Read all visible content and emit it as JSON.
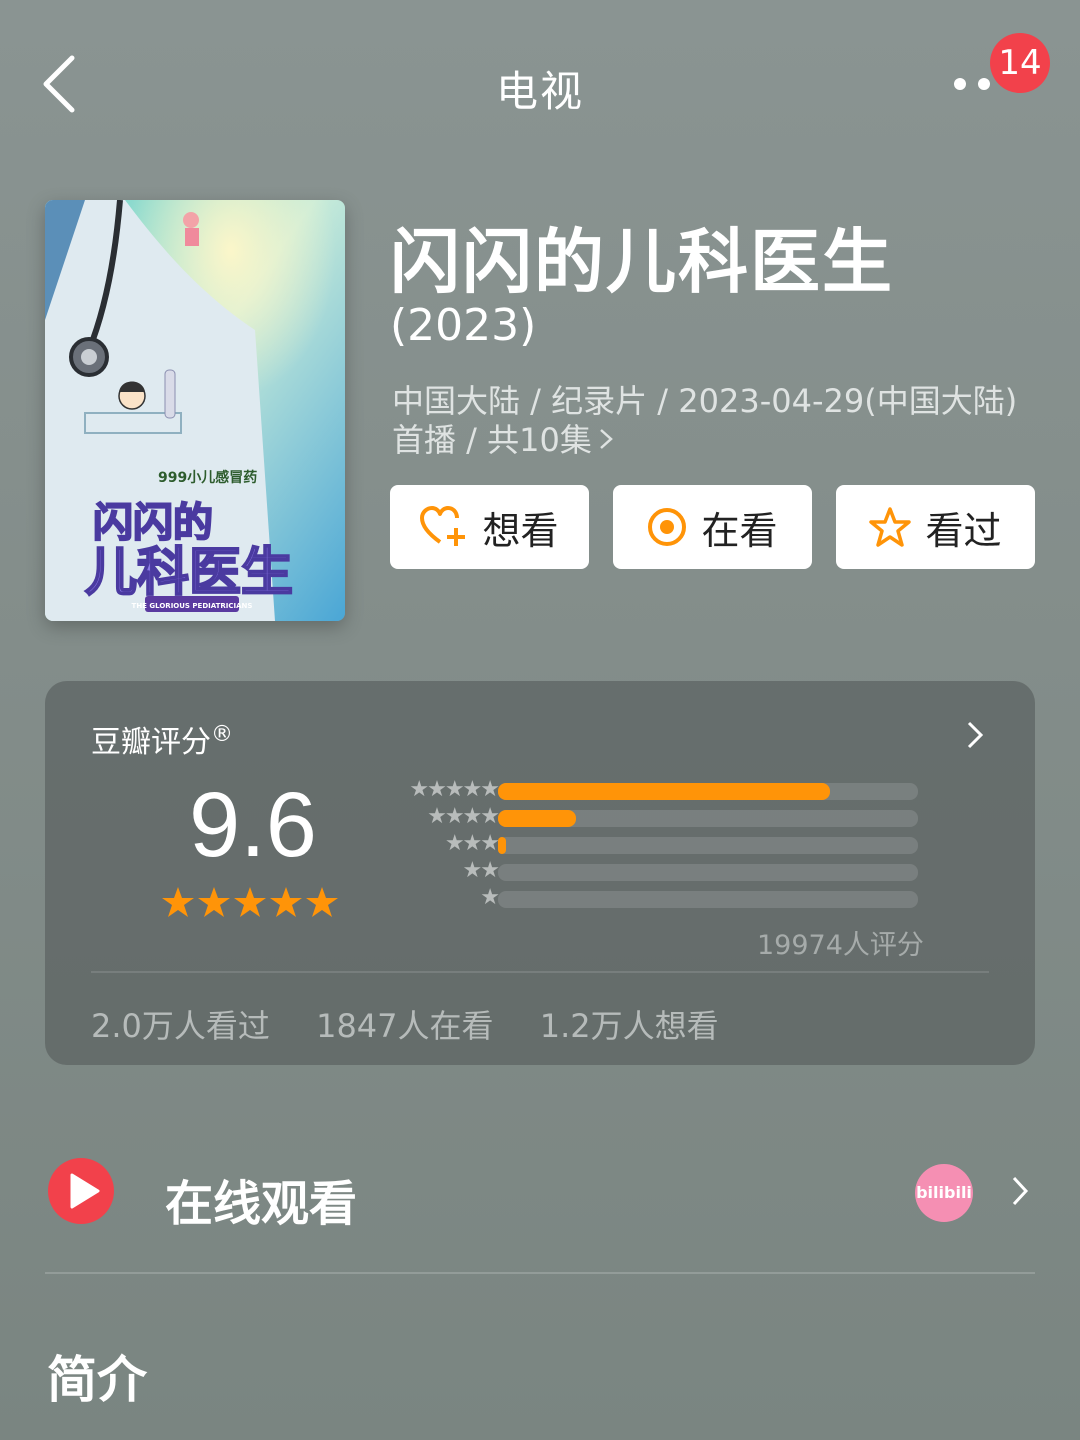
{
  "nav": {
    "title": "电视",
    "badge": "14"
  },
  "movie": {
    "title": "闪闪的儿科医生",
    "year": "(2023)",
    "meta_line1": "中国大陆 / 纪录片 / 2023-04-29(中国大陆)",
    "meta_line2": "首播 / 共10集",
    "poster": {
      "brand": "999小儿感冒药",
      "title": "闪闪的儿科医生",
      "subtitle": "THE GLORIOUS PEDIATRICIANS"
    }
  },
  "actions": {
    "want": "想看",
    "watching": "在看",
    "watched": "看过"
  },
  "rating": {
    "label": "豆瓣评分",
    "registered": "®",
    "score": "9.6",
    "stars": 5,
    "distribution": [
      {
        "stars": 5,
        "fraction": 0.79
      },
      {
        "stars": 4,
        "fraction": 0.185
      },
      {
        "stars": 3,
        "fraction": 0.016
      },
      {
        "stars": 2,
        "fraction": 0.0
      },
      {
        "stars": 1,
        "fraction": 0.0
      }
    ],
    "count": "19974人评分",
    "stats": [
      "2.0万人看过",
      "1847人在看",
      "1.2万人想看"
    ]
  },
  "watch": {
    "label": "在线观看",
    "platform": "bilibili"
  },
  "intro": {
    "label": "简介"
  },
  "colors": {
    "accent": "#ff9408",
    "badge": "#f2414b",
    "bilibili": "#f58fb3"
  }
}
